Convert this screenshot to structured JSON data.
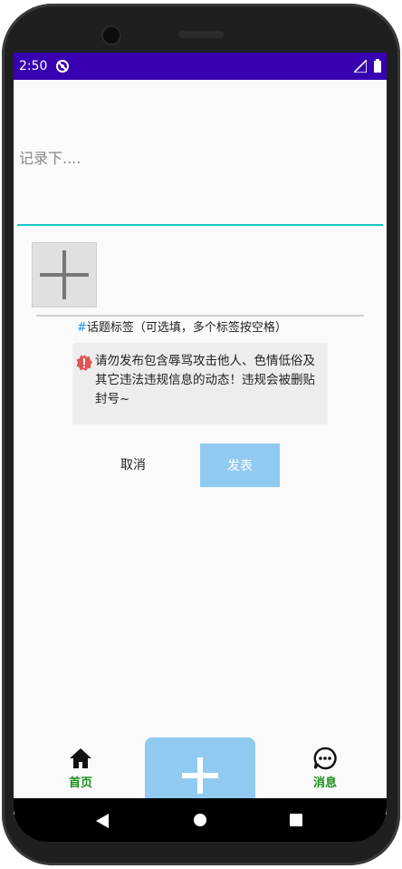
{
  "status_bar": {
    "time": "2:50"
  },
  "compose": {
    "placeholder": "记录下...."
  },
  "tag_hint": {
    "hash": "#",
    "text": "话题标签（可选填，多个标签按空格）"
  },
  "warning": {
    "text": "请勿发布包含辱骂攻击他人、色情低俗及其它违法违规信息的动态！违规会被删贴封号~"
  },
  "actions": {
    "cancel_label": "取消",
    "publish_label": "发表"
  },
  "bottom_nav": {
    "home_label": "首页",
    "message_label": "消息"
  },
  "colors": {
    "status_bar": "#3800b0",
    "accent_underline": "#1ec6c1",
    "publish_button": "#90caf0",
    "nav_label": "#1b8e1b",
    "warning_icon": "#e05555"
  },
  "icons": [
    "sync-icon",
    "signal-icon",
    "battery-icon",
    "plus-icon",
    "warning-icon",
    "home-icon",
    "chat-icon",
    "back-icon"
  ]
}
